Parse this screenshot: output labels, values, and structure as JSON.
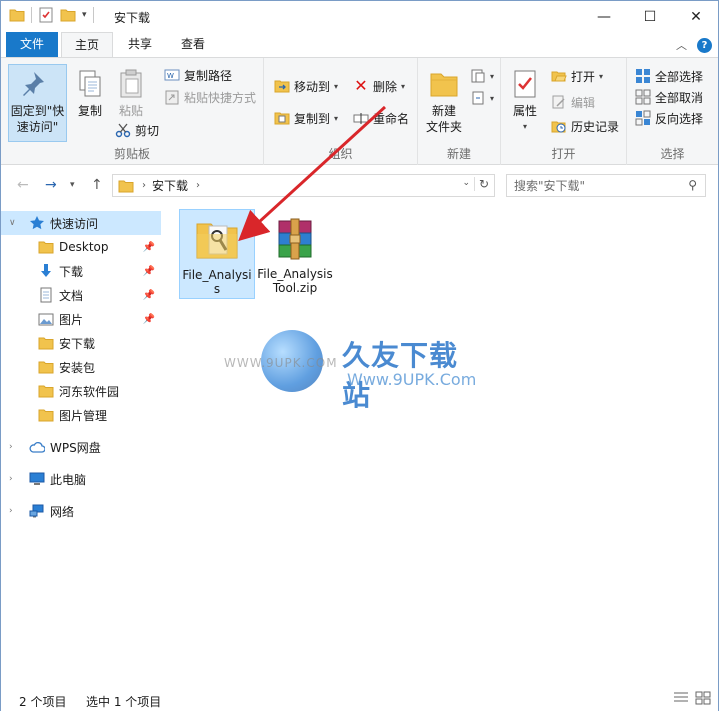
{
  "window": {
    "title": "安下载",
    "controls": [
      "minimize-icon",
      "maximize-icon",
      "close-icon"
    ]
  },
  "ribbon_tabs": [
    "文件",
    "主页",
    "共享",
    "查看"
  ],
  "ribbon": {
    "clipboard": {
      "label": "剪贴板",
      "pin": "固定到\"快\n速访问\"",
      "copy": "复制",
      "paste": "粘贴",
      "copy_path": "复制路径",
      "paste_shortcut": "粘贴快捷方式",
      "cut": "剪切"
    },
    "organize": {
      "label": "组织",
      "move_to": "移动到",
      "copy_to": "复制到",
      "delete": "删除",
      "rename": "重命名"
    },
    "new": {
      "label": "新建",
      "new_folder": "新建\n文件夹"
    },
    "open": {
      "label": "打开",
      "properties": "属性",
      "open": "打开",
      "edit": "编辑",
      "history": "历史记录"
    },
    "select": {
      "label": "选择",
      "select_all": "全部选择",
      "select_none": "全部取消",
      "invert": "反向选择"
    }
  },
  "address": {
    "crumb": "安下载",
    "search_placeholder": "搜索\"安下载\""
  },
  "nav": {
    "quick_access": "快速访问",
    "items": [
      {
        "label": "Desktop",
        "icon": "folder-icon",
        "pinned": true
      },
      {
        "label": "下载",
        "icon": "download-icon",
        "pinned": true
      },
      {
        "label": "文档",
        "icon": "document-icon",
        "pinned": true
      },
      {
        "label": "图片",
        "icon": "picture-icon",
        "pinned": true
      },
      {
        "label": "安下载",
        "icon": "folder-icon",
        "pinned": false
      },
      {
        "label": "安装包",
        "icon": "folder-icon",
        "pinned": false
      },
      {
        "label": "河东软件园",
        "icon": "folder-icon",
        "pinned": false
      },
      {
        "label": "图片管理",
        "icon": "folder-icon",
        "pinned": false
      }
    ],
    "wps": "WPS网盘",
    "this_pc": "此电脑",
    "network": "网络"
  },
  "files": [
    {
      "name": "File_Analysis",
      "icon": "folder-icon",
      "selected": true
    },
    {
      "name": "File_AnalysisTool.zip",
      "icon": "winrar-archive-icon",
      "selected": false
    }
  ],
  "watermark": {
    "www": "WWW.9UPK.COM",
    "title": "久友下载站",
    "url": "Www.9UPK.Com"
  },
  "status": {
    "count": "2 个项目",
    "selected": "选中 1 个项目"
  },
  "colors": {
    "accent": "#1979ca",
    "selection": "#cce8ff",
    "arrow": "#d9262a"
  }
}
